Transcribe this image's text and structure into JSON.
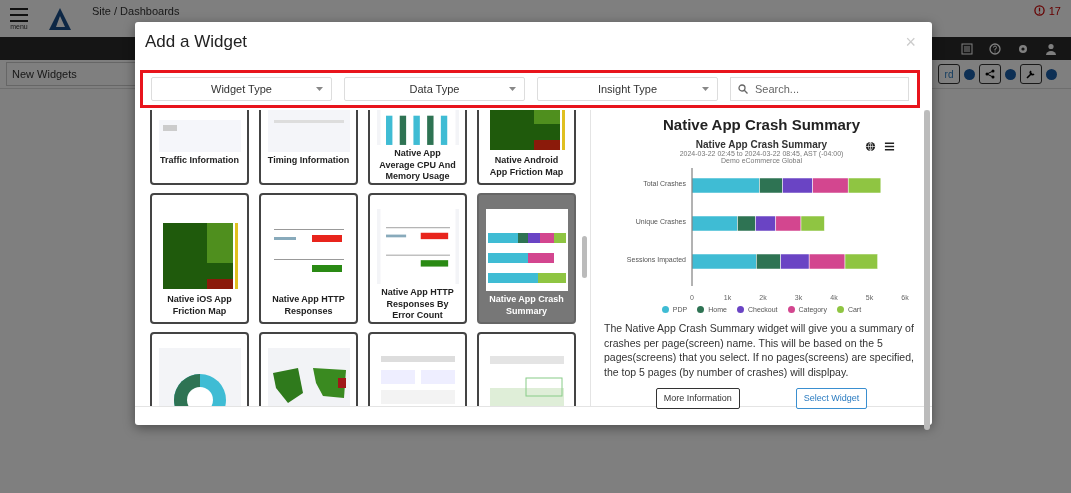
{
  "app_bar": {
    "menu_label": "menu",
    "breadcrumb": "Site / Dashboards",
    "alert_count": "17"
  },
  "toolbar": {
    "dashboard_select": "New Widgets",
    "partial_button": "rd"
  },
  "dialog": {
    "title": "Add a Widget",
    "close": "×",
    "filters": [
      {
        "kind": "select",
        "label": "Widget Type"
      },
      {
        "kind": "select",
        "label": "Data Type"
      },
      {
        "kind": "select",
        "label": "Insight Type"
      },
      {
        "kind": "search",
        "placeholder": "Search..."
      }
    ],
    "widgets": [
      {
        "title": "Traffic Information",
        "selected": false
      },
      {
        "title": "Timing Information",
        "selected": false
      },
      {
        "title": "Native App Average CPU And Memory Usage",
        "selected": false
      },
      {
        "title": "Native Android App Friction Map",
        "selected": false
      },
      {
        "title": "Native iOS App Friction Map",
        "selected": false
      },
      {
        "title": "Native App HTTP Responses",
        "selected": false
      },
      {
        "title": "Native App HTTP Responses By Error Count",
        "selected": false
      },
      {
        "title": "Native App Crash Summary",
        "selected": true
      },
      {
        "selected": false
      },
      {
        "selected": false
      },
      {
        "selected": false
      },
      {
        "selected": false
      }
    ],
    "detail": {
      "title": "Native App Crash Summary",
      "chart_subtitle": [
        "2024-03-22 02:45 to 2024-03-22 08:45, AST (-04:00)",
        "Demo eCommerce Global"
      ],
      "chart_data": {
        "type": "bar",
        "orientation": "horizontal",
        "stacked": true,
        "title": "Native App Crash Summary",
        "categories": [
          "Total Crashes",
          "Unique Crashes",
          "Sessions Impacted"
        ],
        "series": [
          {
            "name": "PDP",
            "color": "#3fbcd4",
            "values": [
              1900,
              1280,
              1810
            ]
          },
          {
            "name": "Home",
            "color": "#2e7353",
            "values": [
              650,
              510,
              690
            ]
          },
          {
            "name": "Checkout",
            "color": "#6a44c4",
            "values": [
              850,
              570,
              800
            ]
          },
          {
            "name": "Category",
            "color": "#d3468f",
            "values": [
              1000,
              710,
              1010
            ]
          },
          {
            "name": "Cart",
            "color": "#8fc542",
            "values": [
              920,
              660,
              920
            ]
          }
        ],
        "xlim": [
          0,
          6000
        ],
        "xticks": [
          {
            "value": 0,
            "label": "0"
          },
          {
            "value": 1000,
            "label": "1k"
          },
          {
            "value": 2000,
            "label": "2k"
          },
          {
            "value": 3000,
            "label": "3k"
          },
          {
            "value": 4000,
            "label": "4k"
          },
          {
            "value": 5000,
            "label": "5k"
          },
          {
            "value": 6000,
            "label": "6k"
          }
        ]
      },
      "description": "The Native App Crash Summary widget will give you a summary of crashes per page(screen) name. This will be based on the 5 pages(screens) that you select. If no pages(screens) are specified, the top 5 pages (by number of crashes) will displpay.",
      "buttons": [
        {
          "kind": "secondary",
          "label": "More Information"
        },
        {
          "kind": "primary",
          "label": "Select Widget"
        }
      ]
    }
  }
}
